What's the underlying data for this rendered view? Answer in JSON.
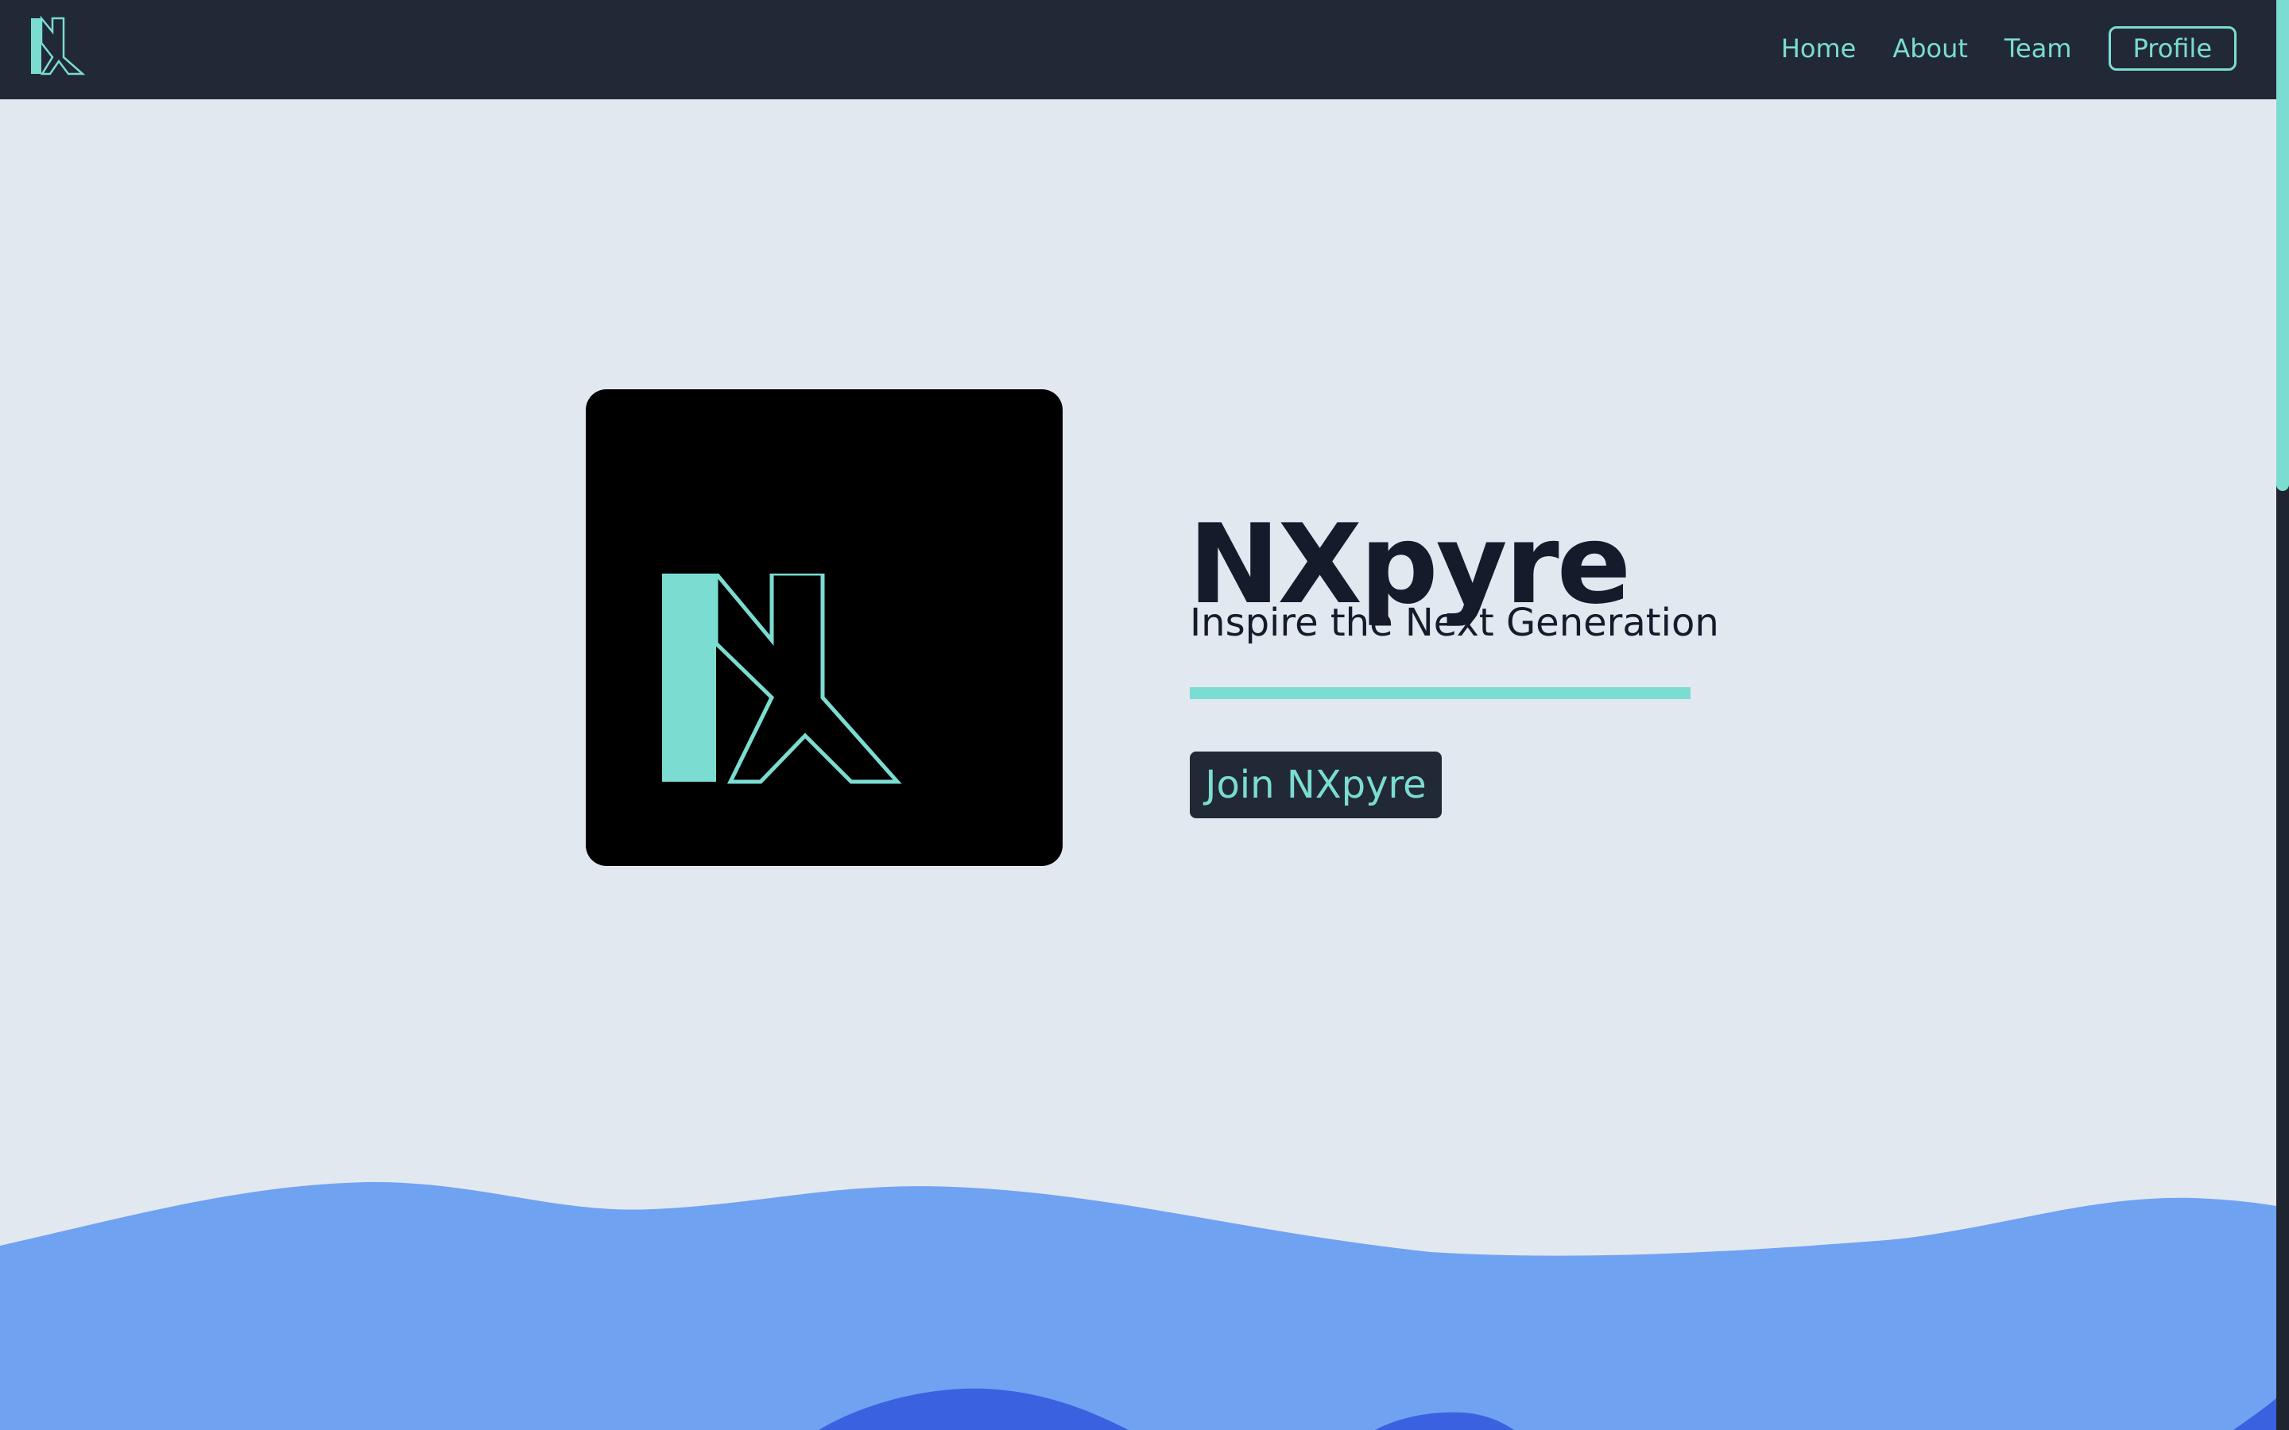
{
  "navbar": {
    "logo_icon": "nxpyre-logo-icon",
    "links": [
      {
        "label": "Home"
      },
      {
        "label": "About"
      },
      {
        "label": "Team"
      }
    ],
    "profile_label": "Profile"
  },
  "hero": {
    "logo_icon": "nxpyre-logo-icon",
    "title": "NXpyre",
    "subtitle": "Inspire the Next Generation",
    "cta_label": "Join NXpyre"
  },
  "colors": {
    "navbar_bg": "#222936",
    "page_bg": "#e2e8f0",
    "accent": "#7bdcd2",
    "text_dark": "#161b2c",
    "wave_light": "#70a2f2",
    "wave_dark": "#3a62e0"
  }
}
